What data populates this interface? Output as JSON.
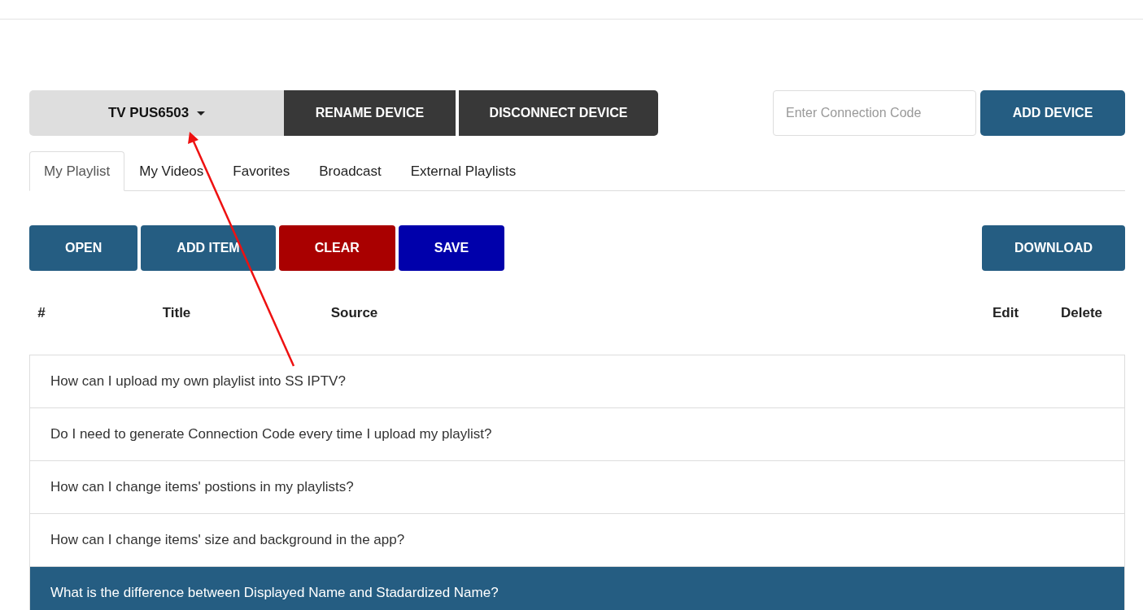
{
  "device_bar": {
    "device": "TV PUS6503",
    "buttons": [
      "RENAME DEVICE",
      "DISCONNECT DEVICE"
    ],
    "connection_code": {
      "placeholder": "Enter Connection Code"
    },
    "add_button": "ADD DEVICE"
  },
  "tabs": [
    {
      "label": "My Playlist",
      "selected": true
    },
    {
      "label": "My Videos",
      "selected": false
    },
    {
      "label": "Favorites",
      "selected": false
    },
    {
      "label": "Broadcast",
      "selected": false
    },
    {
      "label": "External Playlists",
      "selected": false
    }
  ],
  "actions": [
    {
      "label": "OPEN",
      "color": "#255d82"
    },
    {
      "label": "ADD ITEM",
      "color": "#255d82"
    },
    {
      "label": "CLEAR",
      "color": "#a90000"
    },
    {
      "label": "SAVE",
      "color": "#0000ab"
    }
  ],
  "download_button": "DOWNLOAD",
  "table": {
    "columns": [
      "#",
      "Title",
      "Source",
      "Edit",
      "Delete"
    ]
  },
  "faq": [
    {
      "question": "How can I upload my own playlist into SS IPTV?",
      "selected": false
    },
    {
      "question": "Do I need to generate Connection Code every time I upload my playlist?",
      "selected": false
    },
    {
      "question": "How can I change items' postions in my playlists?",
      "selected": false
    },
    {
      "question": "How can I change items' size and background in the app?",
      "selected": false
    },
    {
      "question": "What is the difference between Displayed Name and Stadardized Name?",
      "selected": true
    }
  ]
}
